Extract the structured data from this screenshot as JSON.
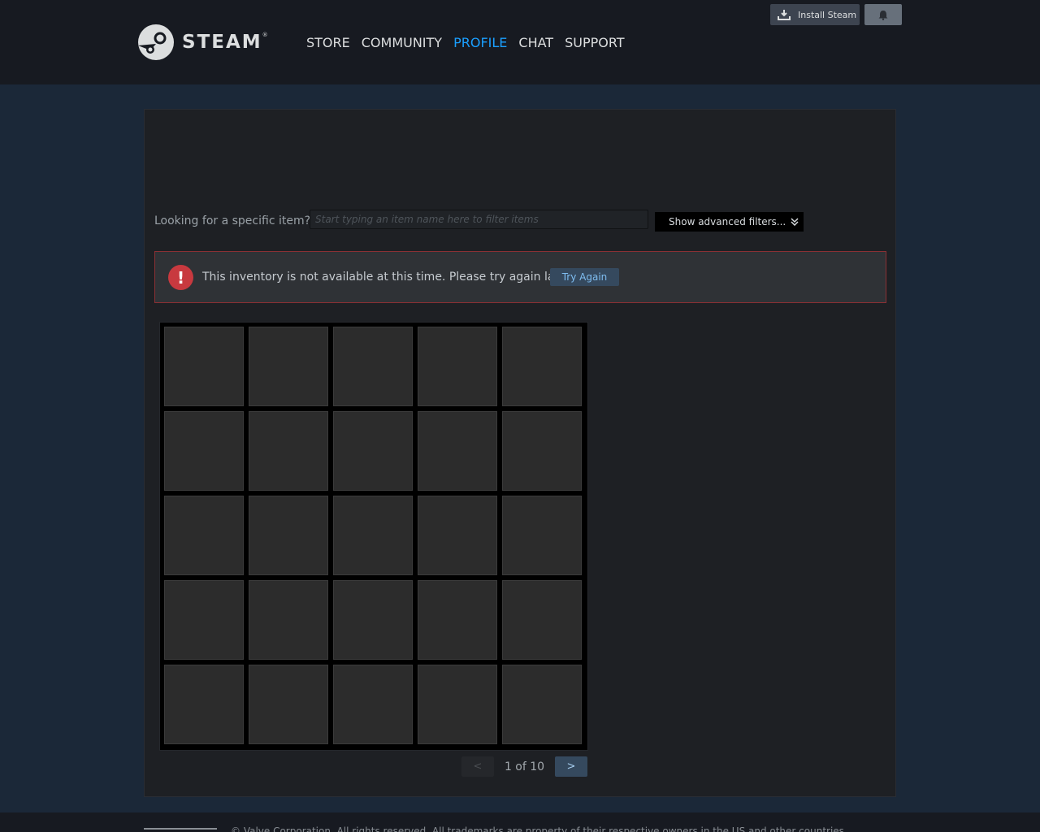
{
  "header": {
    "logo_text": "STEAM",
    "nav": [
      {
        "label": "STORE",
        "active": false
      },
      {
        "label": "COMMUNITY",
        "active": false
      },
      {
        "label": "PROFILE",
        "active": true
      },
      {
        "label": "CHAT",
        "active": false
      },
      {
        "label": "SUPPORT",
        "active": false
      }
    ],
    "install_label": "Install Steam"
  },
  "filter": {
    "label": "Looking for a specific item?",
    "placeholder": "Start typing an item name here to filter items",
    "value": "",
    "advanced_label": "Show advanced filters..."
  },
  "error": {
    "icon": "!",
    "message": "This inventory is not available at this time. Please try again later.",
    "retry_label": "Try Again"
  },
  "inventory": {
    "rows": 5,
    "columns": 5
  },
  "pagination": {
    "prev": "<",
    "next": ">",
    "current_text": "1 of 10"
  },
  "footer": {
    "text": "© Valve Corporation. All rights reserved. All trademarks are property of their respective owners in the US and other countries."
  },
  "colors": {
    "background": "#1b2838",
    "header": "#171a21",
    "active_nav": "#1a9fff",
    "error_border": "#8a3034"
  }
}
